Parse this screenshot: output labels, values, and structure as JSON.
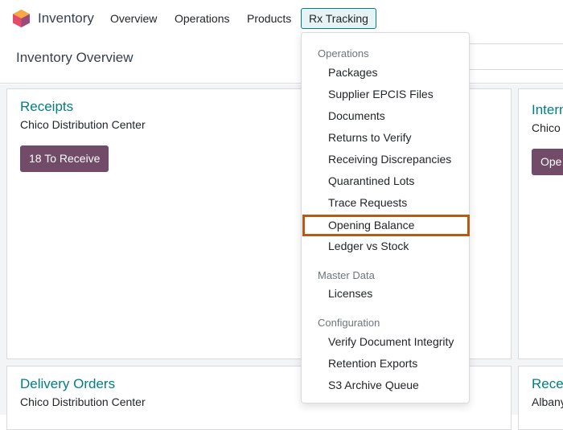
{
  "navbar": {
    "app_name": "Inventory",
    "app_icon": "odoo-inventory-app-icon",
    "items": [
      {
        "label": "Overview"
      },
      {
        "label": "Operations"
      },
      {
        "label": "Products"
      },
      {
        "label": "Rx Tracking",
        "active": true
      }
    ]
  },
  "control_panel": {
    "title": "Inventory Overview"
  },
  "cards": [
    {
      "title": "Receipts",
      "subtitle": "Chico Distribution Center",
      "button": "18 To Receive"
    },
    {
      "title": "Intern",
      "subtitle": "Chico",
      "button": "Ope"
    },
    {
      "title": "Delivery Orders",
      "subtitle": "Chico Distribution Center"
    },
    {
      "title": "Rece",
      "subtitle": "Albany"
    }
  ],
  "dropdown": {
    "sections": [
      {
        "header": "Operations",
        "items": [
          "Packages",
          "Supplier EPCIS Files",
          "Documents",
          "Returns to Verify",
          "Receiving Discrepancies",
          "Quarantined Lots",
          "Trace Requests",
          "Opening Balance",
          "Ledger vs Stock"
        ]
      },
      {
        "header": "Master Data",
        "items": [
          "Licenses"
        ]
      },
      {
        "header": "Configuration",
        "items": [
          "Verify Document Integrity",
          "Retention Exports",
          "S3 Archive Queue"
        ]
      }
    ],
    "focused_item": "Opening Balance"
  },
  "colors": {
    "accent": "#017e84",
    "primary_button": "#714b67",
    "focus_outline": "#b85a12",
    "active_tab_bg": "#e6f2f3"
  }
}
